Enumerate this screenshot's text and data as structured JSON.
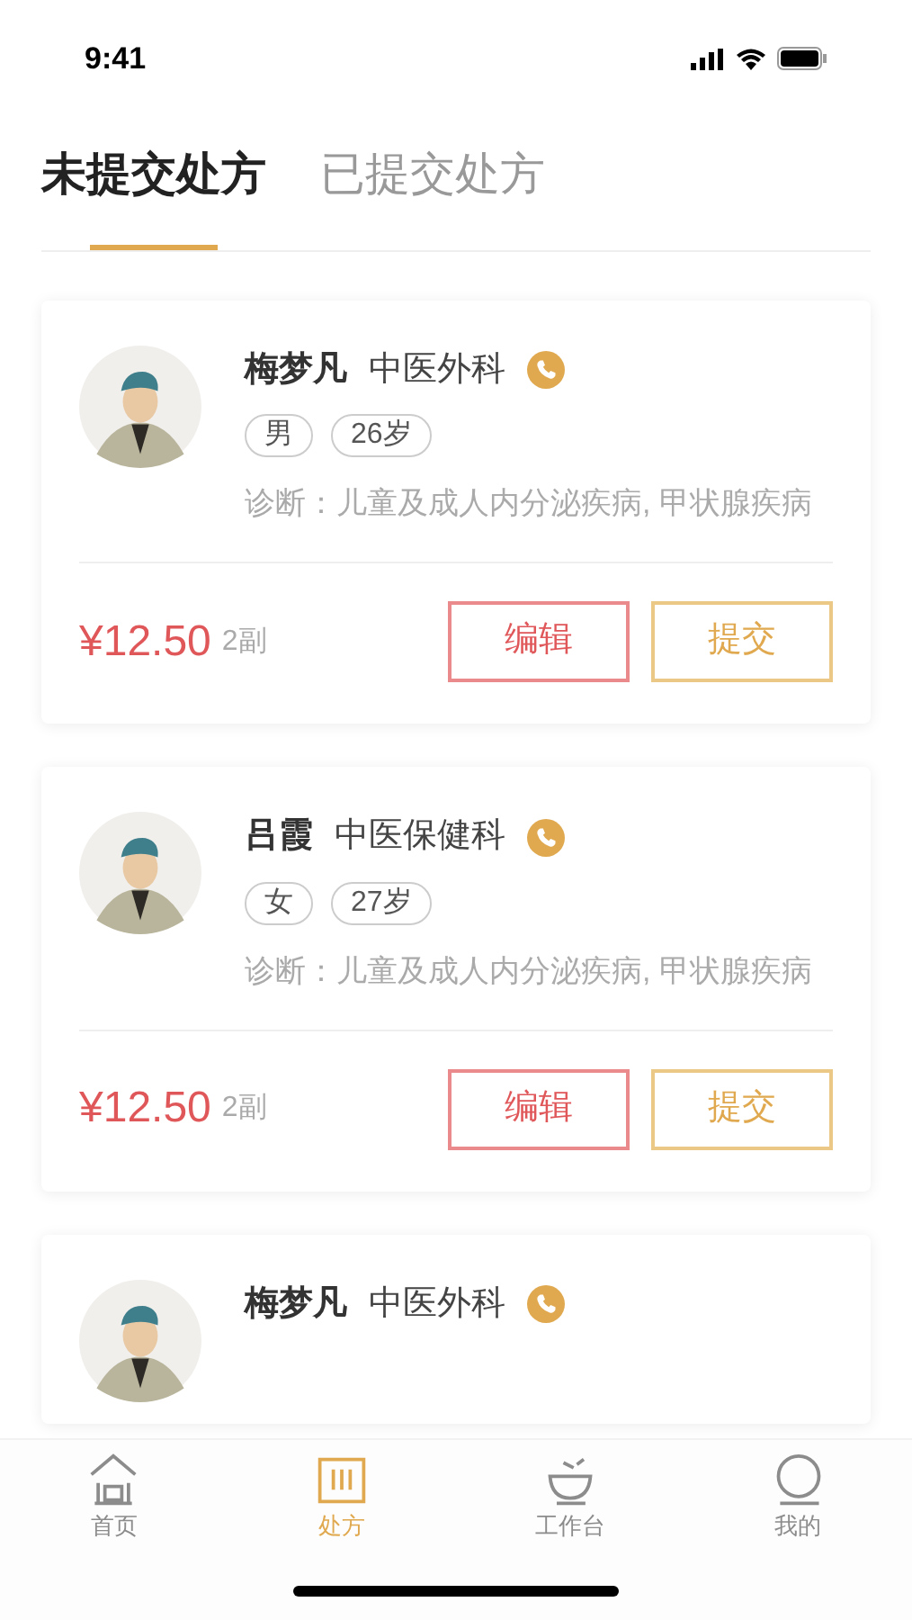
{
  "status_bar": {
    "time": "9:41"
  },
  "tabs": [
    {
      "label": "未提交处方",
      "selected": true
    },
    {
      "label": "已提交处方",
      "selected": false
    }
  ],
  "prescriptions": [
    {
      "name": "梅梦凡",
      "department": "中医外科",
      "gender": "男",
      "age": "26岁",
      "diagnosis": "诊断：儿童及成人内分泌疾病, 甲状腺疾病",
      "price": "¥12.50",
      "doses": "2副",
      "actions": [
        "编辑",
        "提交"
      ]
    },
    {
      "name": "吕霞",
      "department": "中医保健科",
      "gender": "女",
      "age": "27岁",
      "diagnosis": "诊断：儿童及成人内分泌疾病, 甲状腺疾病",
      "price": "¥12.50",
      "doses": "2副",
      "actions": [
        "编辑",
        "提交"
      ]
    },
    {
      "name": "梅梦凡",
      "department": "中医外科"
    }
  ],
  "tab_bar": [
    {
      "label": "首页",
      "kind": "home",
      "selected": false
    },
    {
      "label": "处方",
      "kind": "prescription",
      "selected": true
    },
    {
      "label": "工作台",
      "kind": "bowl",
      "selected": false
    },
    {
      "label": "我的",
      "kind": "profile",
      "selected": false
    }
  ]
}
